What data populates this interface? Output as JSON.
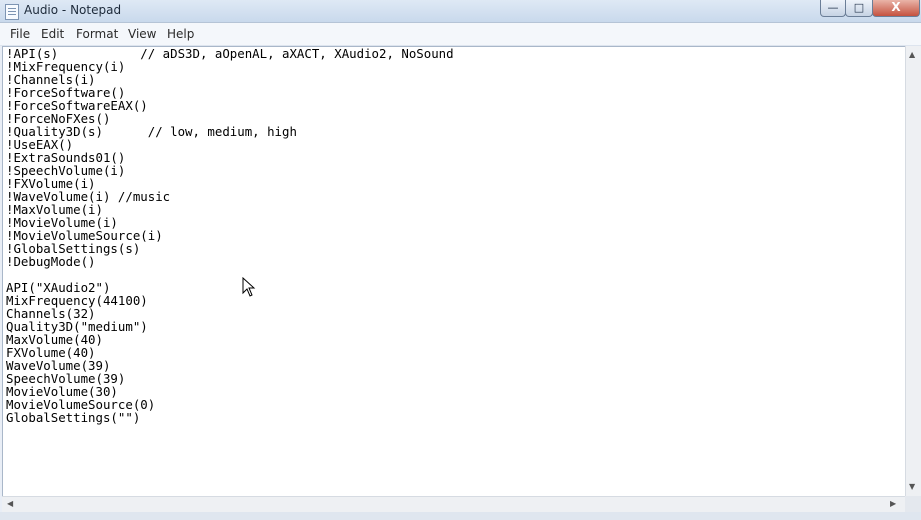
{
  "window": {
    "title": "Audio - Notepad"
  },
  "controls": {
    "minimize": "—",
    "maximize": "□",
    "close": "X"
  },
  "menu": {
    "items": [
      "File",
      "Edit",
      "Format",
      "View",
      "Help"
    ]
  },
  "editor": {
    "content": "!API(s)           // aDS3D, aOpenAL, aXACT, XAudio2, NoSound\n!MixFrequency(i)\n!Channels(i)\n!ForceSoftware()\n!ForceSoftwareEAX()\n!ForceNoFXes()\n!Quality3D(s)      // low, medium, high\n!UseEAX()\n!ExtraSounds01()\n!SpeechVolume(i)\n!FXVolume(i)\n!WaveVolume(i) //music\n!MaxVolume(i)\n!MovieVolume(i)\n!MovieVolumeSource(i)\n!GlobalSettings(s)\n!DebugMode()\n\nAPI(\"XAudio2\")\nMixFrequency(44100)\nChannels(32)\nQuality3D(\"medium\")\nMaxVolume(40)\nFXVolume(40)\nWaveVolume(39)\nSpeechVolume(39)\nMovieVolume(30)\nMovieVolumeSource(0)\nGlobalSettings(\"\")"
  },
  "scrollbars": {
    "up_arrow": "▲",
    "down_arrow": "▼",
    "left_arrow": "◀",
    "right_arrow": "▶"
  }
}
